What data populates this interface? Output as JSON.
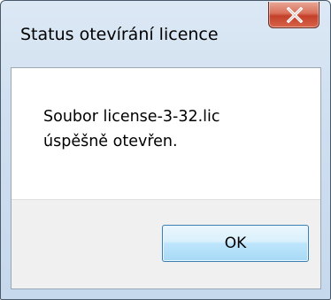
{
  "window": {
    "title": "Status otevírání licence"
  },
  "message": {
    "line1": "Soubor license-3-32.lic",
    "line2": "úspěšně otevřen."
  },
  "buttons": {
    "ok_label": "OK"
  },
  "icons": {
    "close": "close-icon"
  },
  "colors": {
    "close_button": "#c4402a",
    "ok_button_border": "#3c7fb1",
    "footer_bg": "#f0f0f0"
  }
}
